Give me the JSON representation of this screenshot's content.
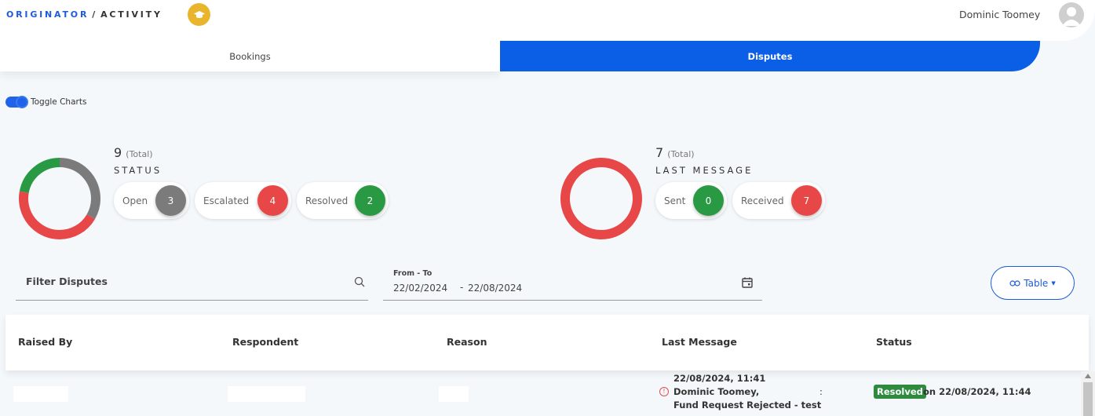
{
  "header": {
    "breadcrumb_1": "ORIGINATOR",
    "breadcrumb_sep": "/",
    "breadcrumb_2": "ACTIVITY",
    "logo_icon": "graduation-cap-icon",
    "user_name": "Dominic Toomey"
  },
  "tabs": [
    {
      "label": "Bookings",
      "active": false
    },
    {
      "label": "Disputes",
      "active": true
    }
  ],
  "toggle": {
    "label": "Toggle Charts",
    "on": true
  },
  "status_chart": {
    "total": "9",
    "total_suffix": "(Total)",
    "title": "STATUS",
    "items": [
      {
        "label": "Open",
        "count": "3",
        "color": "#7b7b7b"
      },
      {
        "label": "Escalated",
        "count": "4",
        "color": "#e84747"
      },
      {
        "label": "Resolved",
        "count": "2",
        "color": "#2a9944"
      }
    ]
  },
  "message_chart": {
    "total": "7",
    "total_suffix": "(Total)",
    "title": "LAST MESSAGE",
    "items": [
      {
        "label": "Sent",
        "count": "0",
        "color": "#2a9944"
      },
      {
        "label": "Received",
        "count": "7",
        "color": "#e84747"
      }
    ]
  },
  "filters": {
    "search_label": "Filter Disputes",
    "date_label": "From - To",
    "date_from": "22/02/2024",
    "date_dash": "-",
    "date_to": "22/08/2024",
    "view_button": "Table"
  },
  "table": {
    "headers": [
      "Raised By",
      "Respondent",
      "Reason",
      "Last Message",
      "Status"
    ],
    "rows": [
      {
        "last_message_time": "22/08/2024, 11:41",
        "last_message_author": "Dominic Toomey,",
        "last_message_text": "Fund Request Rejected - test",
        "last_message_colon": ":",
        "status": "Resolved",
        "status_date": "on 22/08/2024, 11:44"
      }
    ]
  }
}
